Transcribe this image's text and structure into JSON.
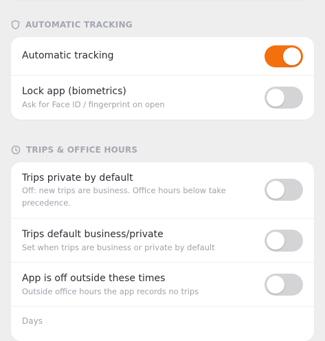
{
  "sections": {
    "automatic": {
      "header": "AUTOMATIC TRACKING",
      "icon": "shield-icon",
      "rows": {
        "auto": {
          "title": "Automatic tracking",
          "on": true
        },
        "lock": {
          "title": "Lock app (biometrics)",
          "subtitle": "Ask for Face ID / fingerprint on open",
          "on": false
        }
      }
    },
    "trips": {
      "header": "TRIPS & OFFICE HOURS",
      "icon": "clock-icon",
      "rows": {
        "private": {
          "title": "Trips private by default",
          "subtitle": "Off: new trips are business. Office hours below take precedence.",
          "on": false
        },
        "default": {
          "title": "Trips default business/private",
          "subtitle": "Set when trips are business or private by default",
          "on": false
        },
        "off": {
          "title": "App is off outside these times",
          "subtitle": "Outside office hours the app records no trips",
          "on": false
        }
      },
      "days_label": "Days"
    }
  },
  "colors": {
    "accent": "#f4700f",
    "toggle_off": "#d4d4d6",
    "header_text": "#a3a7b0"
  }
}
